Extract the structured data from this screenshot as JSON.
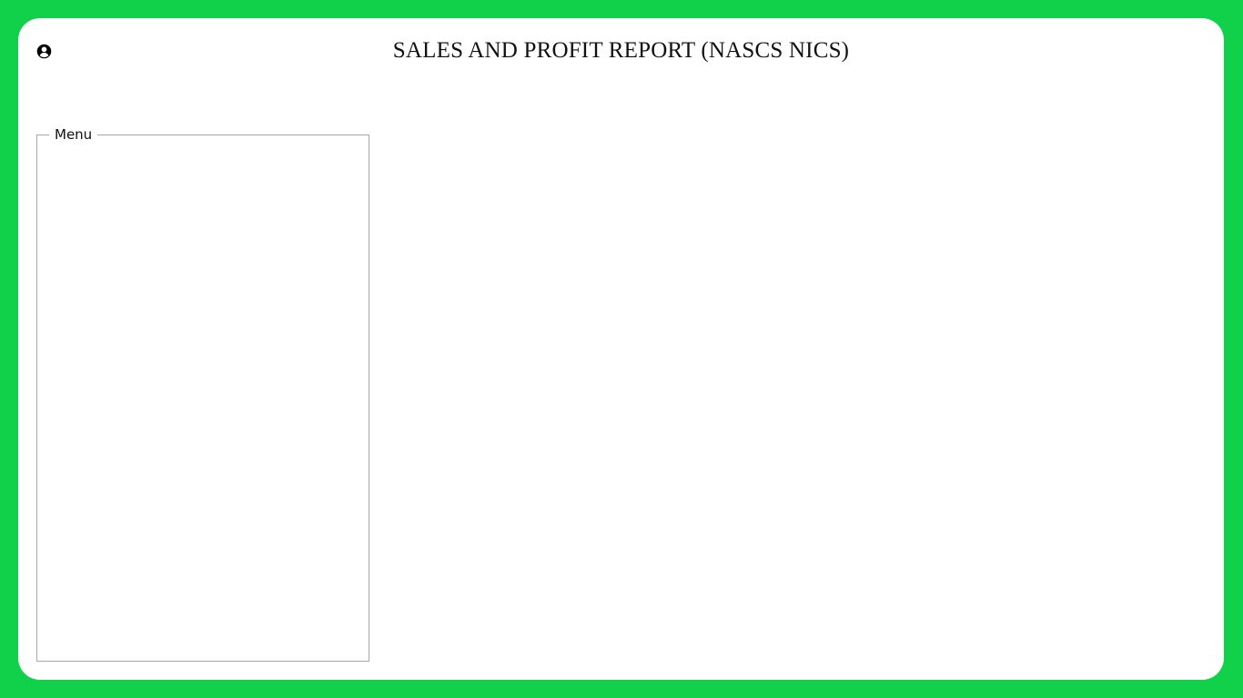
{
  "header": {
    "title": "SALES AND PROFIT REPORT (NASCS NICS)",
    "user_icon": "user-circle-icon"
  },
  "menu": {
    "legend": "Menu",
    "items": []
  },
  "colors": {
    "background": "#11d14a",
    "panel": "#ffffff",
    "border": "#a7a7a7",
    "text": "#111111"
  }
}
